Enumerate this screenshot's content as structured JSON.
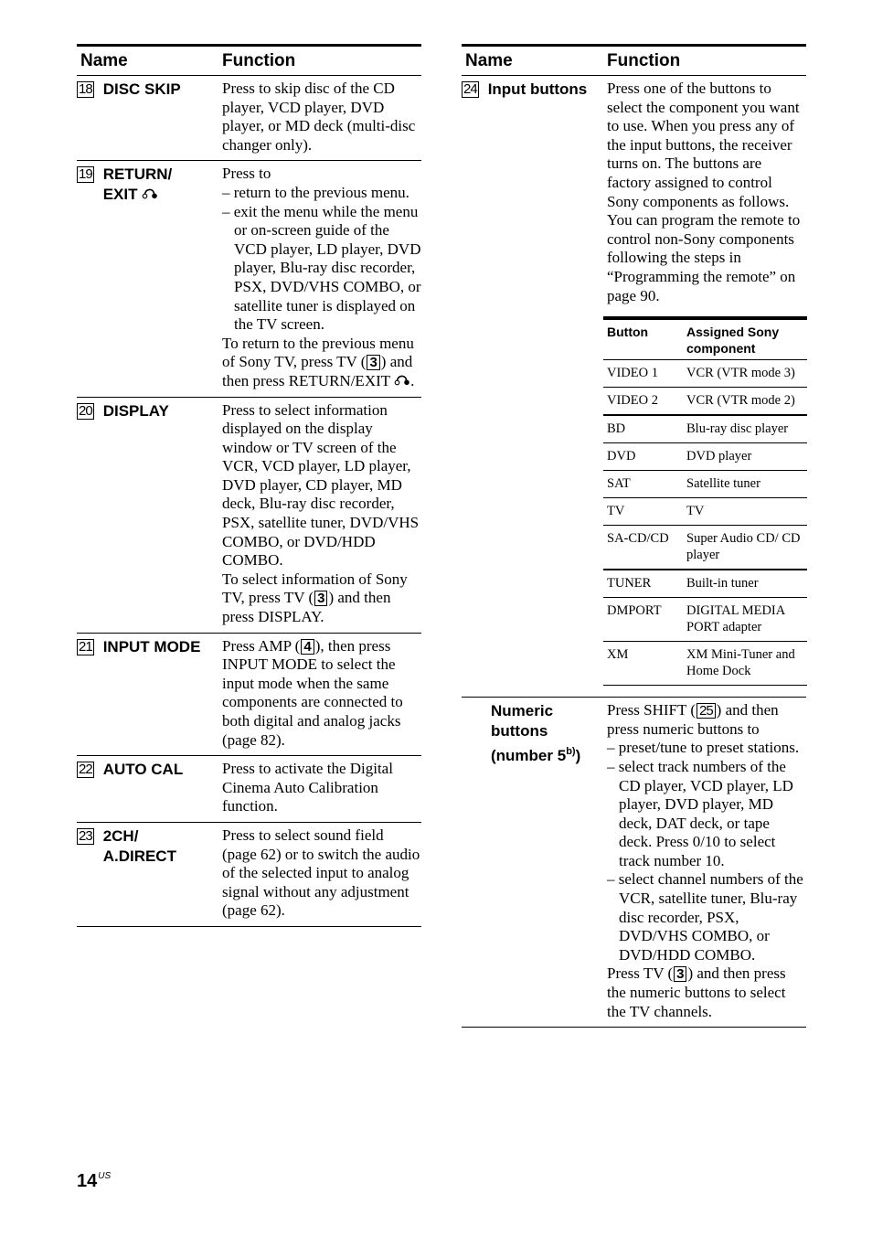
{
  "page": {
    "number": "14",
    "suffix": "US"
  },
  "left_table": {
    "header": {
      "name": "Name",
      "function": "Function"
    },
    "rows": [
      {
        "num": "18",
        "name": "DISC SKIP",
        "text": "Press to skip disc of the CD player, VCD player, DVD player, or MD deck (multi-disc changer only)."
      },
      {
        "num": "19",
        "name_line1": "RETURN/",
        "name_line2": "EXIT",
        "intro": "Press to",
        "bullets": [
          "return to the previous menu.",
          "exit the menu while the menu or on-screen guide of the VCD player, LD player, DVD player, Blu-ray disc recorder, PSX, DVD/VHS COMBO, or satellite tuner is displayed on the TV screen."
        ],
        "after_a": "To return to the previous menu of Sony TV, press TV (",
        "key": "3",
        "after_b": ") and then press RETURN/EXIT",
        "after_c": "."
      },
      {
        "num": "20",
        "name": "DISPLAY",
        "text": "Press to select information displayed on the display window or TV screen of the VCR, VCD player, LD player, DVD player, CD player, MD deck, Blu-ray disc recorder, PSX, satellite tuner, DVD/VHS COMBO, or DVD/HDD COMBO.",
        "after_a": "To select information of Sony TV, press TV (",
        "key": "3",
        "after_b": ") and then press DISPLAY."
      },
      {
        "num": "21",
        "name": "INPUT MODE",
        "text_a": "Press AMP (",
        "key": "4",
        "text_b": "), then press INPUT MODE to select the input mode when the same components are connected to both digital and analog jacks (page 82)."
      },
      {
        "num": "22",
        "name": "AUTO CAL",
        "text": "Press to activate the Digital Cinema Auto Calibration function."
      },
      {
        "num": "23",
        "name_line1": "2CH/",
        "name_line2": "A.DIRECT",
        "text": "Press to select sound field (page 62) or to switch the audio of the selected input to analog signal without any adjustment (page 62)."
      }
    ]
  },
  "right_table": {
    "header": {
      "name": "Name",
      "function": "Function"
    },
    "input_buttons": {
      "num": "24",
      "name": "Input buttons",
      "text": "Press one of the buttons to select the component you want to use. When you press any of the input buttons, the receiver turns on. The buttons are factory assigned to control Sony components as follows. You can program the remote to control non-Sony components following the steps in “Programming the remote” on page 90.",
      "sub_table": {
        "header": {
          "button": "Button",
          "component": "Assigned Sony component"
        },
        "rows": [
          {
            "button": "VIDEO 1",
            "component": "VCR (VTR mode 3)"
          },
          {
            "button": "VIDEO 2",
            "component": "VCR (VTR mode 2)"
          },
          {
            "button": "BD",
            "component": "Blu-ray disc player"
          },
          {
            "button": "DVD",
            "component": "DVD player"
          },
          {
            "button": "SAT",
            "component": "Satellite tuner"
          },
          {
            "button": "TV",
            "component": "TV"
          },
          {
            "button": "SA-CD/CD",
            "component": "Super Audio CD/ CD player"
          },
          {
            "button": "TUNER",
            "component": "Built-in tuner"
          },
          {
            "button": "DMPORT",
            "component": "DIGITAL MEDIA PORT adapter"
          },
          {
            "button": "XM",
            "component": "XM Mini-Tuner and Home Dock"
          }
        ]
      }
    },
    "numeric_buttons": {
      "name_line1": "Numeric",
      "name_line2": "buttons",
      "name_line3": "(number 5",
      "footnote": "b)",
      "name_close": ")",
      "intro_a": "Press SHIFT (",
      "key": "25",
      "intro_b": ") and then press numeric buttons to",
      "bullets": [
        "preset/tune to preset stations.",
        "select track numbers of the CD player, VCD player, LD player, DVD player, MD deck, DAT deck, or tape deck. Press 0/10 to select track number 10.",
        "select channel numbers of the VCR, satellite tuner, Blu-ray disc recorder, PSX, DVD/VHS COMBO, or DVD/HDD COMBO."
      ],
      "after_a": "Press TV (",
      "key2": "3",
      "after_b": ") and then press the numeric buttons to select the TV channels."
    }
  },
  "icons": {
    "return_exit": "return-exit-icon"
  }
}
